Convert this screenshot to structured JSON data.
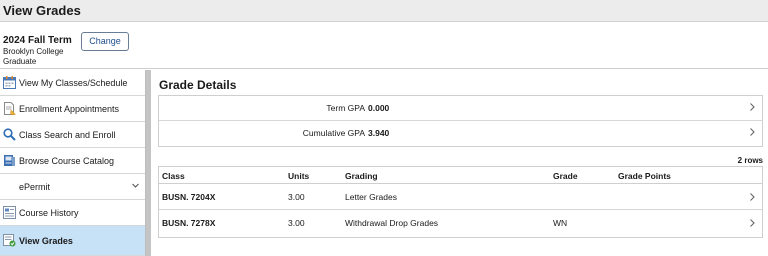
{
  "header": {
    "title": "View Grades"
  },
  "term": {
    "name": "2024 Fall Term",
    "college": "Brooklyn College",
    "career": "Graduate",
    "change_label": "Change"
  },
  "sidebar": {
    "items": [
      {
        "label": "View My Classes/Schedule",
        "icon": "calendar-icon"
      },
      {
        "label": "Enrollment Appointments",
        "icon": "enrollment-document-icon"
      },
      {
        "label": "Class Search and Enroll",
        "icon": "search-icon"
      },
      {
        "label": "Browse Course Catalog",
        "icon": "catalog-icon"
      },
      {
        "label": "ePermit",
        "icon": "chevron-down-icon"
      },
      {
        "label": "Course History",
        "icon": "history-icon"
      },
      {
        "label": "View Grades",
        "icon": "grades-icon"
      }
    ]
  },
  "main": {
    "section_title": "Grade Details",
    "gpa": [
      {
        "label": "Term GPA",
        "value": "0.000"
      },
      {
        "label": "Cumulative GPA",
        "value": "3.940"
      }
    ],
    "row_count": "2 rows",
    "columns": [
      "Class",
      "Units",
      "Grading",
      "Grade",
      "Grade Points"
    ],
    "rows": [
      {
        "class": "BUSN. 7204X",
        "units": "3.00",
        "grading": "Letter Grades",
        "grade": "",
        "points": ""
      },
      {
        "class": "BUSN. 7278X",
        "units": "3.00",
        "grading": "Withdrawal Drop Grades",
        "grade": "WN",
        "points": ""
      }
    ]
  },
  "colors": {
    "selected_nav": "#c7e1f7",
    "accent": "#1f4e8c"
  }
}
